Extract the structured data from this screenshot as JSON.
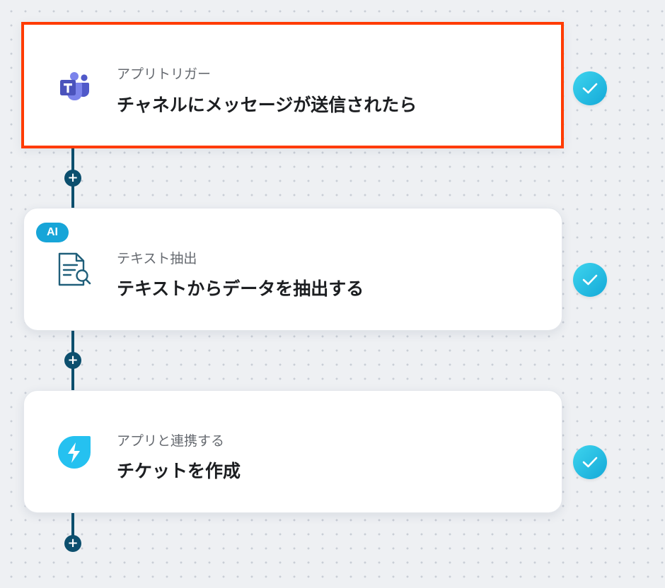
{
  "colors": {
    "accent_connector": "#0c4f6e",
    "selected_border": "#ff3b00",
    "check_cyan": "#1eb8e0",
    "ai_badge": "#17a5d8"
  },
  "add_symbol": "+",
  "steps": [
    {
      "icon": "microsoft-teams-icon",
      "subtitle": "アプリトリガー",
      "title": "チャネルにメッセージが送信されたら",
      "selected": true,
      "status_icon": "check-icon"
    },
    {
      "icon": "document-search-icon",
      "badge": "AI",
      "subtitle": "テキスト抽出",
      "title": "テキストからデータを抽出する",
      "selected": false,
      "status_icon": "check-icon"
    },
    {
      "icon": "freshdesk-lightning-icon",
      "subtitle": "アプリと連携する",
      "title": "チケットを作成",
      "selected": false,
      "status_icon": "check-icon"
    }
  ]
}
